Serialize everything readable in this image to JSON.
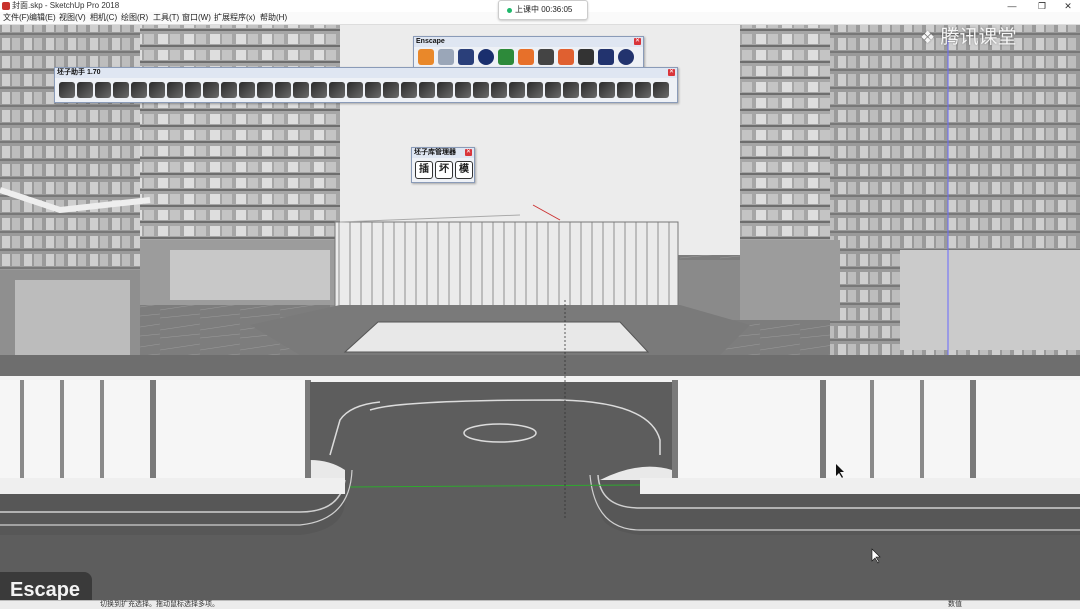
{
  "window": {
    "title": "封面.skp - SketchUp Pro 2018",
    "controls": [
      "minimize-icon",
      "maximize-icon",
      "close-icon"
    ]
  },
  "menubar": {
    "items": [
      "文件(F)",
      "编辑(E)",
      "视图(V)",
      "相机(C)",
      "绘图(R)",
      "工具(T)",
      "窗口(W)",
      "扩展程序(x)",
      "帮助(H)"
    ]
  },
  "recording": {
    "label": "上课中 00:36:05",
    "status_color": "#1fb86b"
  },
  "escape_panel": {
    "title": "Enscape",
    "icons": [
      "enscape-start-icon",
      "refresh-icon",
      "layers-icon",
      "add-asset-icon",
      "tree-icon",
      "fire-icon",
      "material-icon",
      "cloud-upload-icon",
      "settings-icon",
      "mail-icon",
      "info-icon"
    ]
  },
  "helper_panel": {
    "title": "坯子助手 1.70",
    "icon_count": 34
  },
  "library_panel": {
    "title": "坯子库管理器",
    "buttons": [
      "插",
      "坏",
      "模"
    ]
  },
  "watermark": {
    "text": "腾讯课堂"
  },
  "badge": {
    "text": "Escape"
  },
  "statusbar": {
    "hint": "切换到扩充选择。拖动鼠标选择多项。",
    "value_label": "数值"
  },
  "colors": {
    "panel_bg": "#eef1f6",
    "panel_border": "#8a9bb8",
    "close_red": "#d9343a",
    "axis_green": "#2fa82f",
    "axis_red": "#cc3333"
  }
}
